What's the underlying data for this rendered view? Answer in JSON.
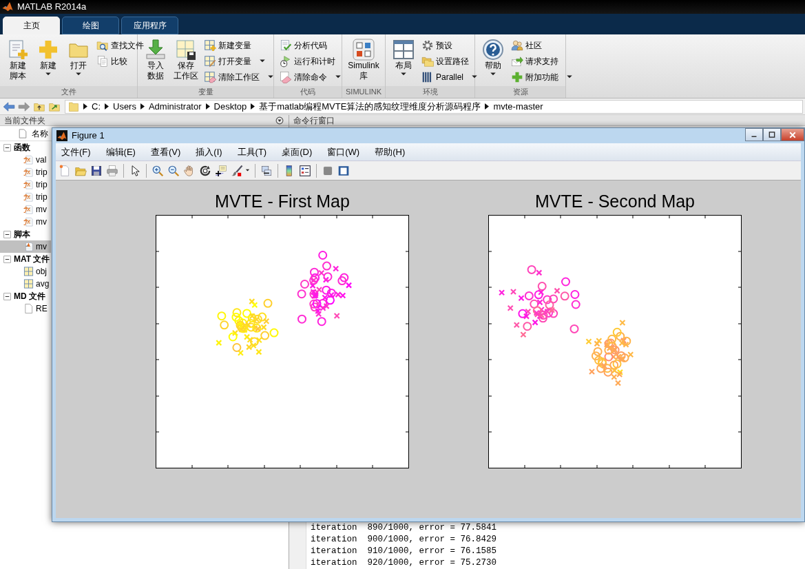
{
  "app": {
    "title": "MATLAB R2014a"
  },
  "tabs": [
    {
      "label": "主页",
      "selected": true
    },
    {
      "label": "绘图",
      "selected": false
    },
    {
      "label": "应用程序",
      "selected": false
    }
  ],
  "ribbon": [
    {
      "label": "文件",
      "items": [
        {
          "kind": "large",
          "lines": [
            "新建",
            "脚本"
          ],
          "has_menu": false
        },
        {
          "kind": "large",
          "lines": [
            "新建"
          ],
          "has_menu": true
        },
        {
          "kind": "large",
          "lines": [
            "打开"
          ],
          "has_menu": true
        },
        {
          "kind": "small",
          "label": "查找文件",
          "has_menu": false
        },
        {
          "kind": "small",
          "label": "比较",
          "has_menu": false
        }
      ]
    },
    {
      "label": "变量",
      "items": [
        {
          "kind": "large",
          "lines": [
            "导入",
            "数据"
          ],
          "has_menu": false
        },
        {
          "kind": "large",
          "lines": [
            "保存",
            "工作区"
          ],
          "has_menu": false
        },
        {
          "kind": "small",
          "label": "新建变量",
          "has_menu": false
        },
        {
          "kind": "small",
          "label": "打开变量",
          "has_menu": true
        },
        {
          "kind": "small",
          "label": "清除工作区",
          "has_menu": true
        }
      ]
    },
    {
      "label": "代码",
      "items": [
        {
          "kind": "small",
          "label": "分析代码",
          "has_menu": false
        },
        {
          "kind": "small",
          "label": "运行和计时",
          "has_menu": false
        },
        {
          "kind": "small",
          "label": "清除命令",
          "has_menu": true
        }
      ]
    },
    {
      "label": "SIMULINK",
      "items": [
        {
          "kind": "large",
          "lines": [
            "Simulink",
            "库"
          ],
          "has_menu": false
        }
      ]
    },
    {
      "label": "环境",
      "items": [
        {
          "kind": "large",
          "lines": [
            "布局"
          ],
          "has_menu": true
        },
        {
          "kind": "small",
          "label": "预设",
          "has_menu": false
        },
        {
          "kind": "small",
          "label": "设置路径",
          "has_menu": false
        },
        {
          "kind": "small",
          "label": "Parallel",
          "has_menu": true
        }
      ]
    },
    {
      "label": "资源",
      "items": [
        {
          "kind": "large",
          "lines": [
            "帮助"
          ],
          "has_menu": true
        },
        {
          "kind": "small",
          "label": "社区",
          "has_menu": false
        },
        {
          "kind": "small",
          "label": "请求支持",
          "has_menu": false
        },
        {
          "kind": "small",
          "label": "附加功能",
          "has_menu": true
        }
      ]
    }
  ],
  "address_bar": {
    "crumbs": [
      "C:",
      "Users",
      "Administrator",
      "Desktop",
      "基于matlab编程MVTE算法的感知纹理维度分析源码程序",
      "mvte-master"
    ]
  },
  "current_folder": {
    "title": "当前文件夹",
    "column": "名称",
    "sections": [
      {
        "label": "函数",
        "expanded": true,
        "children": [
          {
            "label": "val",
            "selected": false
          },
          {
            "label": "trip",
            "selected": false
          },
          {
            "label": "trip",
            "selected": false
          },
          {
            "label": "trip",
            "selected": false
          },
          {
            "label": "mv",
            "selected": false
          },
          {
            "label": "mv",
            "selected": false
          }
        ]
      },
      {
        "label": "脚本",
        "expanded": true,
        "children": [
          {
            "label": "mv",
            "selected": true
          }
        ]
      },
      {
        "label": "MAT 文件",
        "expanded": true,
        "children": [
          {
            "label": "obj",
            "selected": false
          },
          {
            "label": "avg",
            "selected": false
          }
        ]
      },
      {
        "label": "MD 文件",
        "expanded": true,
        "children": [
          {
            "label": "RE",
            "selected": false
          }
        ]
      }
    ]
  },
  "command_window": {
    "title": "命令行窗口",
    "lines": [
      "iteration  890/1000, error = 77.5841",
      "iteration  900/1000, error = 76.8429",
      "iteration  910/1000, error = 76.1585",
      "iteration  920/1000, error = 75.2730"
    ]
  },
  "figure": {
    "title": "Figure 1",
    "menu": [
      "文件(F)",
      "编辑(E)",
      "查看(V)",
      "插入(I)",
      "工具(T)",
      "桌面(D)",
      "窗口(W)",
      "帮助(H)"
    ],
    "plots": [
      {
        "title": "MVTE - First Map"
      },
      {
        "title": "MVTE - Second Map"
      }
    ]
  }
}
